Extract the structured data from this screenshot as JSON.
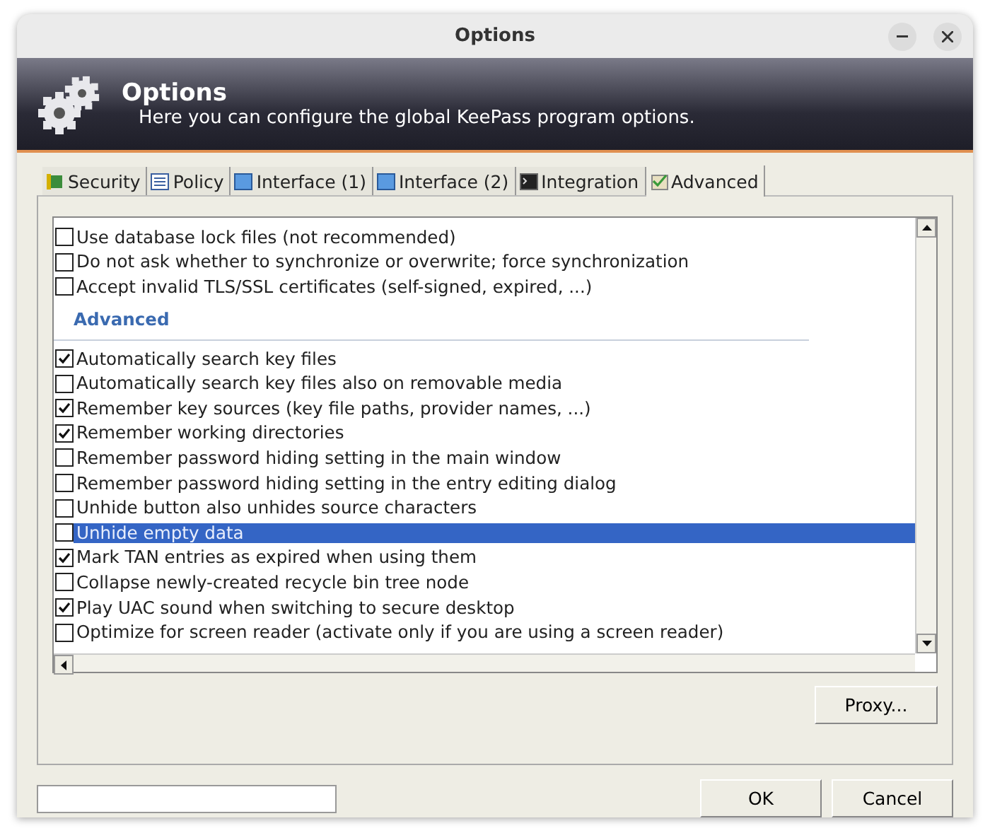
{
  "window": {
    "title": "Options"
  },
  "banner": {
    "title": "Options",
    "subtitle": "Here you can configure the global KeePass program options."
  },
  "tabs": [
    {
      "label": "Security",
      "selected": false
    },
    {
      "label": "Policy",
      "selected": false
    },
    {
      "label": "Interface (1)",
      "selected": false
    },
    {
      "label": "Interface (2)",
      "selected": false
    },
    {
      "label": "Integration",
      "selected": false
    },
    {
      "label": "Advanced",
      "selected": true
    }
  ],
  "options": [
    {
      "kind": "checkbox",
      "label": "Use database lock files (not recommended)",
      "checked": false,
      "selected": false
    },
    {
      "kind": "checkbox",
      "label": "Do not ask whether to synchronize or overwrite; force synchronization",
      "checked": false,
      "selected": false
    },
    {
      "kind": "checkbox",
      "label": "Accept invalid TLS/SSL certificates (self-signed, expired, ...)",
      "checked": false,
      "selected": false
    },
    {
      "kind": "heading",
      "label": "Advanced"
    },
    {
      "kind": "checkbox",
      "label": "Automatically search key files",
      "checked": true,
      "selected": false
    },
    {
      "kind": "checkbox",
      "label": "Automatically search key files also on removable media",
      "checked": false,
      "selected": false
    },
    {
      "kind": "checkbox",
      "label": "Remember key sources (key file paths, provider names, ...)",
      "checked": true,
      "selected": false
    },
    {
      "kind": "checkbox",
      "label": "Remember working directories",
      "checked": true,
      "selected": false
    },
    {
      "kind": "checkbox",
      "label": "Remember password hiding setting in the main window",
      "checked": false,
      "selected": false
    },
    {
      "kind": "checkbox",
      "label": "Remember password hiding setting in the entry editing dialog",
      "checked": false,
      "selected": false
    },
    {
      "kind": "checkbox",
      "label": "Unhide button also unhides source characters",
      "checked": false,
      "selected": false
    },
    {
      "kind": "checkbox",
      "label": "Unhide empty data",
      "checked": false,
      "selected": true
    },
    {
      "kind": "checkbox",
      "label": "Mark TAN entries as expired when using them",
      "checked": true,
      "selected": false
    },
    {
      "kind": "checkbox",
      "label": "Collapse newly-created recycle bin tree node",
      "checked": false,
      "selected": false
    },
    {
      "kind": "checkbox",
      "label": "Play UAC sound when switching to secure desktop",
      "checked": true,
      "selected": false
    },
    {
      "kind": "checkbox",
      "label": "Optimize for screen reader (activate only if you are using a screen reader)",
      "checked": false,
      "selected": false
    }
  ],
  "proxy_button": "Proxy...",
  "buttons": [
    "OK",
    "Cancel"
  ]
}
